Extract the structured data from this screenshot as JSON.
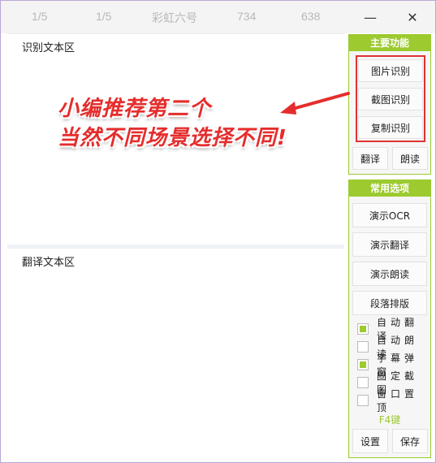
{
  "titlebar": {
    "items": [
      "1/5",
      "1/5",
      "彩虹六号",
      "734",
      "638"
    ],
    "minimize_glyph": "—",
    "close_glyph": "✕"
  },
  "main": {
    "recognize_area_label": "识别文本区",
    "translate_area_label": "翻译文本区"
  },
  "main_features": {
    "header": "主要功能",
    "image_ocr": "图片识别",
    "screenshot_ocr": "截图识别",
    "copy_ocr": "复制识别",
    "translate": "翻译",
    "read_aloud": "朗读"
  },
  "common_options": {
    "header": "常用选项",
    "demo_ocr": "演示OCR",
    "demo_translate": "演示翻译",
    "demo_read": "演示朗读",
    "paragraph_layout": "段落排版",
    "checkboxes": [
      {
        "label": "自动翻译",
        "checked": true
      },
      {
        "label": "自动朗读",
        "checked": false
      },
      {
        "label": "字幕弹窗",
        "checked": true
      },
      {
        "label": "固定截图",
        "checked": false
      },
      {
        "label": "窗口置顶",
        "checked": false
      }
    ],
    "hotkey_hint": "F4键",
    "settings": "设置",
    "save": "保存"
  },
  "annotation": {
    "line1": "小编推荐第二个",
    "line2": "当然不同场景选择不同!"
  },
  "colors": {
    "accent": "#9cca2f",
    "highlight": "#e03232",
    "annotation": "#e52d2d"
  }
}
